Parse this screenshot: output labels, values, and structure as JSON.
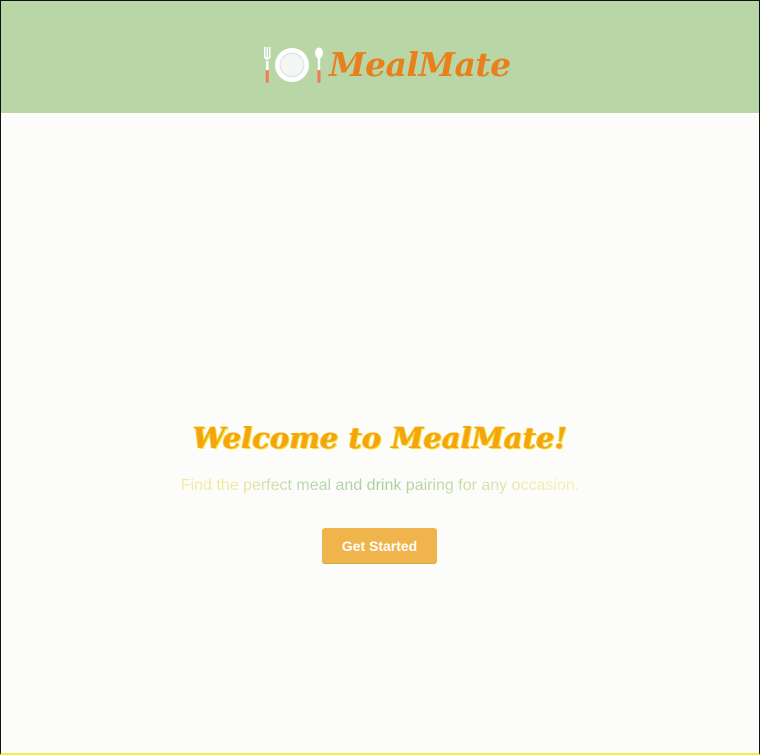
{
  "header": {
    "brand": {
      "name": "MealMate",
      "logo_icon": "plate-cutlery-icon"
    }
  },
  "hero": {
    "title": "Welcome to MealMate!",
    "tagline": "Find the perfect meal and drink pairing for any occasion.",
    "cta_label": "Get Started"
  },
  "colors": {
    "header_bg": "#b9d7a6",
    "brand_text": "#e8801c",
    "title_text": "#f6a40e",
    "button_bg": "#f0b44c",
    "button_text": "#ffffff",
    "page_bg": "#fcfcfa"
  }
}
